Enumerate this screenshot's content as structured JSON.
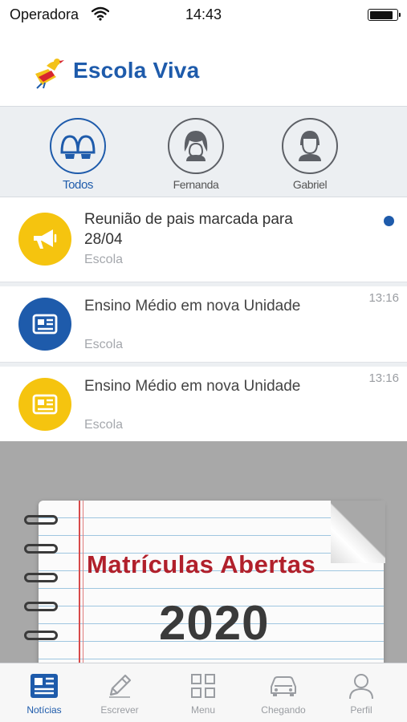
{
  "status_bar": {
    "carrier": "Operadora",
    "time": "14:43"
  },
  "header": {
    "app_name": "Escola Viva",
    "brand_color": "#1e5bab"
  },
  "filters": [
    {
      "label": "Todos",
      "active": true,
      "icon": "group-icon"
    },
    {
      "label": "Fernanda",
      "active": false,
      "icon": "girl-avatar-icon"
    },
    {
      "label": "Gabriel",
      "active": false,
      "icon": "boy-avatar-icon"
    }
  ],
  "feed": [
    {
      "title": "Reunião de pais marcada para 28/04",
      "source": "Escola",
      "time": "",
      "unread": true,
      "icon": "megaphone-icon",
      "icon_color": "#f5c40f"
    },
    {
      "title": "Ensino Médio em nova Unidade",
      "source": "Escola",
      "time": "13:16",
      "unread": false,
      "icon": "newspaper-icon",
      "icon_color": "#1e5bab"
    },
    {
      "title": "Ensino Médio em nova Unidade",
      "source": "Escola",
      "time": "13:16",
      "unread": false,
      "icon": "newspaper-icon",
      "icon_color": "#f5c40f"
    }
  ],
  "banner": {
    "headline": "Matrículas Abertas",
    "year": "2020"
  },
  "tabs": [
    {
      "label": "Notícias",
      "active": true,
      "icon": "news-icon"
    },
    {
      "label": "Escrever",
      "active": false,
      "icon": "pencil-icon"
    },
    {
      "label": "Menu",
      "active": false,
      "icon": "grid-icon"
    },
    {
      "label": "Chegando",
      "active": false,
      "icon": "car-icon"
    },
    {
      "label": "Perfil",
      "active": false,
      "icon": "person-icon"
    }
  ]
}
